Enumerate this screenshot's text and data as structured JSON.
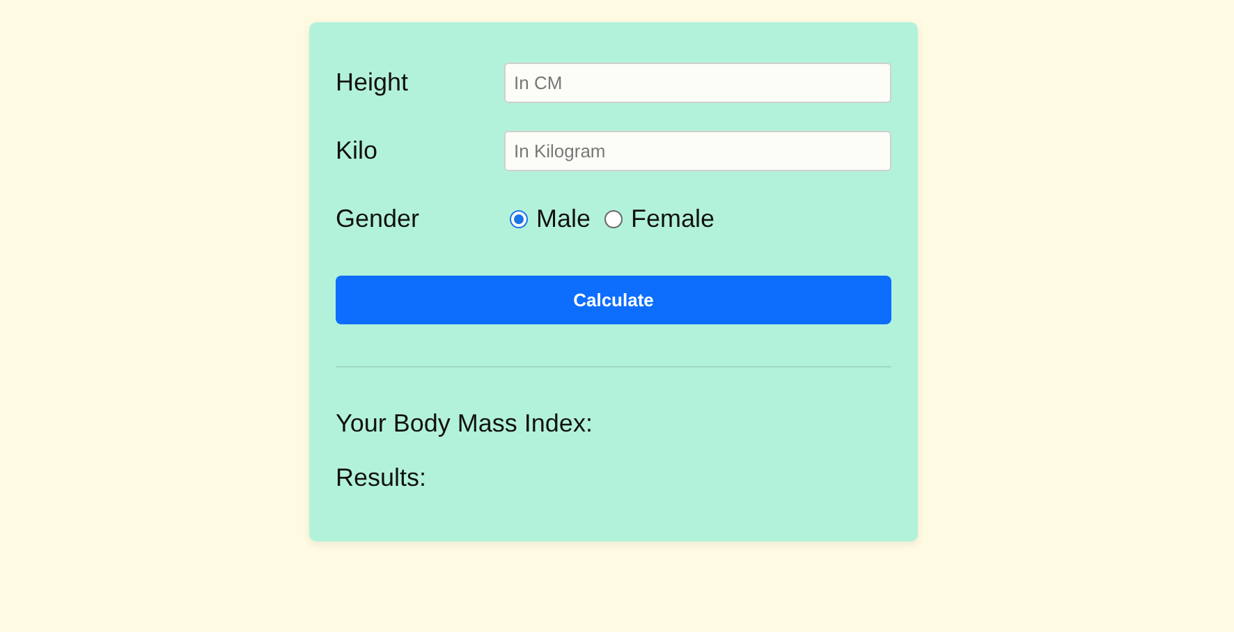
{
  "fields": [
    {
      "label": "Height",
      "placeholder": "In CM"
    },
    {
      "label": "Kilo",
      "placeholder": "In Kilogram"
    }
  ],
  "gender": {
    "label": "Gender",
    "options": [
      {
        "label": "Male",
        "selected": true
      },
      {
        "label": "Female",
        "selected": false
      }
    ]
  },
  "button": "Calculate",
  "results": [
    "Your Body Mass Index:",
    "Results:"
  ]
}
